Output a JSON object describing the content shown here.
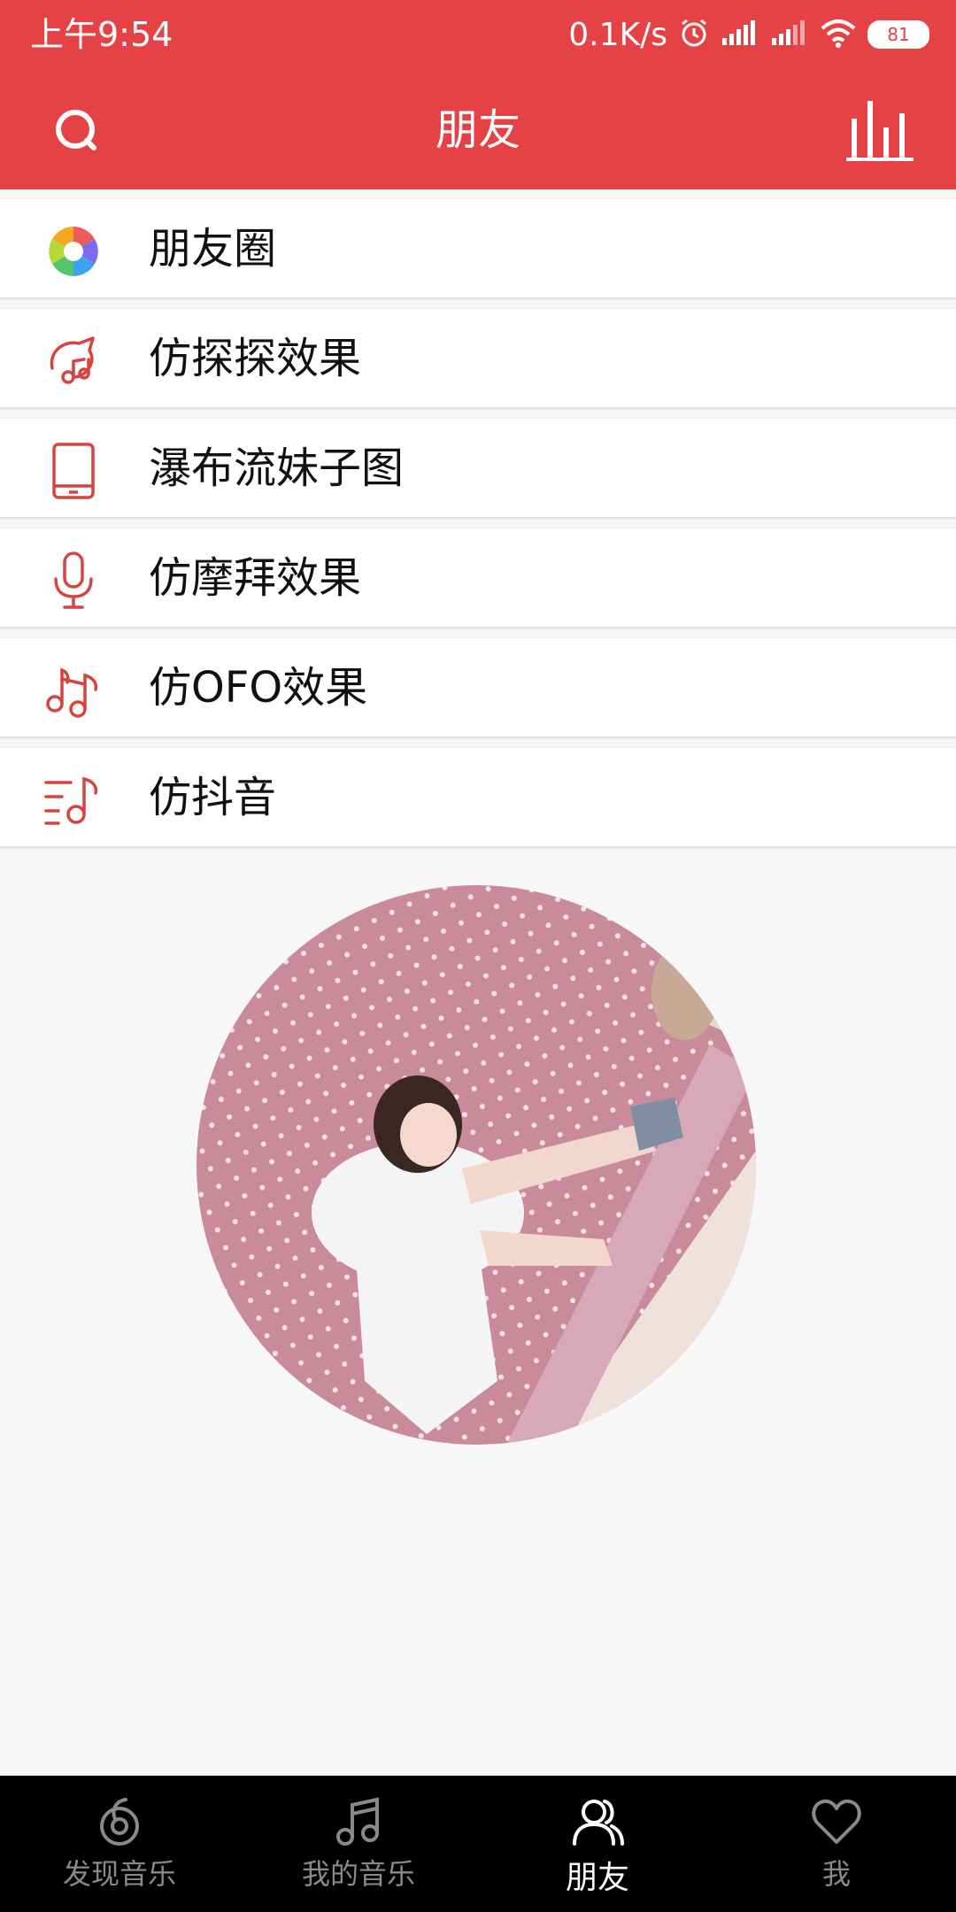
{
  "status_bar": {
    "time": "上午9:54",
    "speed": "0.1K/s",
    "battery": "81"
  },
  "header": {
    "title": "朋友",
    "search_icon": "search-icon",
    "stats_icon": "equalizer-icon"
  },
  "menu": {
    "items": [
      {
        "label": "朋友圈",
        "icon": "moments-aperture-icon"
      },
      {
        "label": "仿探探效果",
        "icon": "bell-music-icon"
      },
      {
        "label": "瀑布流妹子图",
        "icon": "phone-icon"
      },
      {
        "label": "仿摩拜效果",
        "icon": "microphone-icon"
      },
      {
        "label": "仿OFO效果",
        "icon": "music-note-icon"
      },
      {
        "label": "仿抖音",
        "icon": "playlist-icon"
      }
    ]
  },
  "bottom_nav": {
    "tabs": [
      {
        "label": "发现音乐",
        "icon": "discover-music-icon",
        "active": false
      },
      {
        "label": "我的音乐",
        "icon": "my-music-icon",
        "active": false
      },
      {
        "label": "朋友",
        "icon": "friends-icon",
        "active": true
      },
      {
        "label": "我",
        "icon": "heart-icon",
        "active": false
      }
    ]
  },
  "colors": {
    "brand": "#e54246",
    "icon_red": "#d9433f",
    "nav_bg": "#000000"
  }
}
